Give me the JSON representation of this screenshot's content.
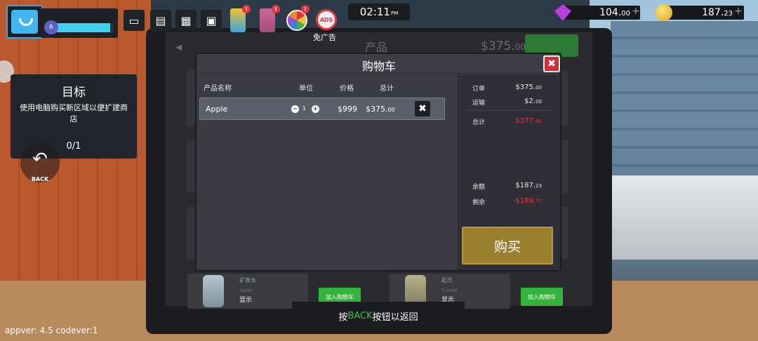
{
  "hud": {
    "level": "6",
    "xp_fraction": 0.95,
    "clock": "02:11",
    "clock_ampm": "PM",
    "no_ads_label": "免广告",
    "gems": {
      "main": "104.",
      "cents": "00",
      "plus": "+"
    },
    "coins": {
      "main": "187.",
      "cents": "23",
      "plus": "+"
    }
  },
  "objective": {
    "title": "目标",
    "description": "使用电脑购买新区域以便扩建商店",
    "progress": "0/1"
  },
  "back_button": {
    "label": "BACK"
  },
  "app": {
    "title": "产品",
    "price_main": "$375.",
    "price_cents": "00",
    "bottom_cards": [
      {
        "name": "矿泉水",
        "sub": "Aotte",
        "show": "显示",
        "add": "加入购物车"
      },
      {
        "name": "起司",
        "sub": "Comté",
        "show": "显示",
        "add": "加入购物车"
      }
    ]
  },
  "cart": {
    "title": "购物车",
    "columns": {
      "name": "产品名称",
      "unit": "单位",
      "price": "价格",
      "total": "总计"
    },
    "items": [
      {
        "name": "Apple",
        "qty": "1",
        "price": "$999",
        "total_main": "$375.",
        "total_cents": "00"
      }
    ],
    "summary": {
      "order_label": "订单",
      "order_main": "$375.",
      "order_cents": "00",
      "shipping_label": "运输",
      "shipping_main": "$2.",
      "shipping_cents": "00",
      "total_label": "总计",
      "total_main": "$377.",
      "total_cents": "00",
      "balance_label": "余额",
      "balance_main": "$187.",
      "balance_cents": "23",
      "remaining_label": "剩余",
      "remaining_main": "-$189.",
      "remaining_cents": "77"
    },
    "buy_label": "购买",
    "colors": {
      "buy": "#9a7f2f",
      "negative": "#e3343f",
      "close": "#d0303a"
    }
  },
  "hint": {
    "pre": "按",
    "key": "BACK",
    "post": "按钮以返回"
  },
  "version": "appver: 4.5 codever:1"
}
